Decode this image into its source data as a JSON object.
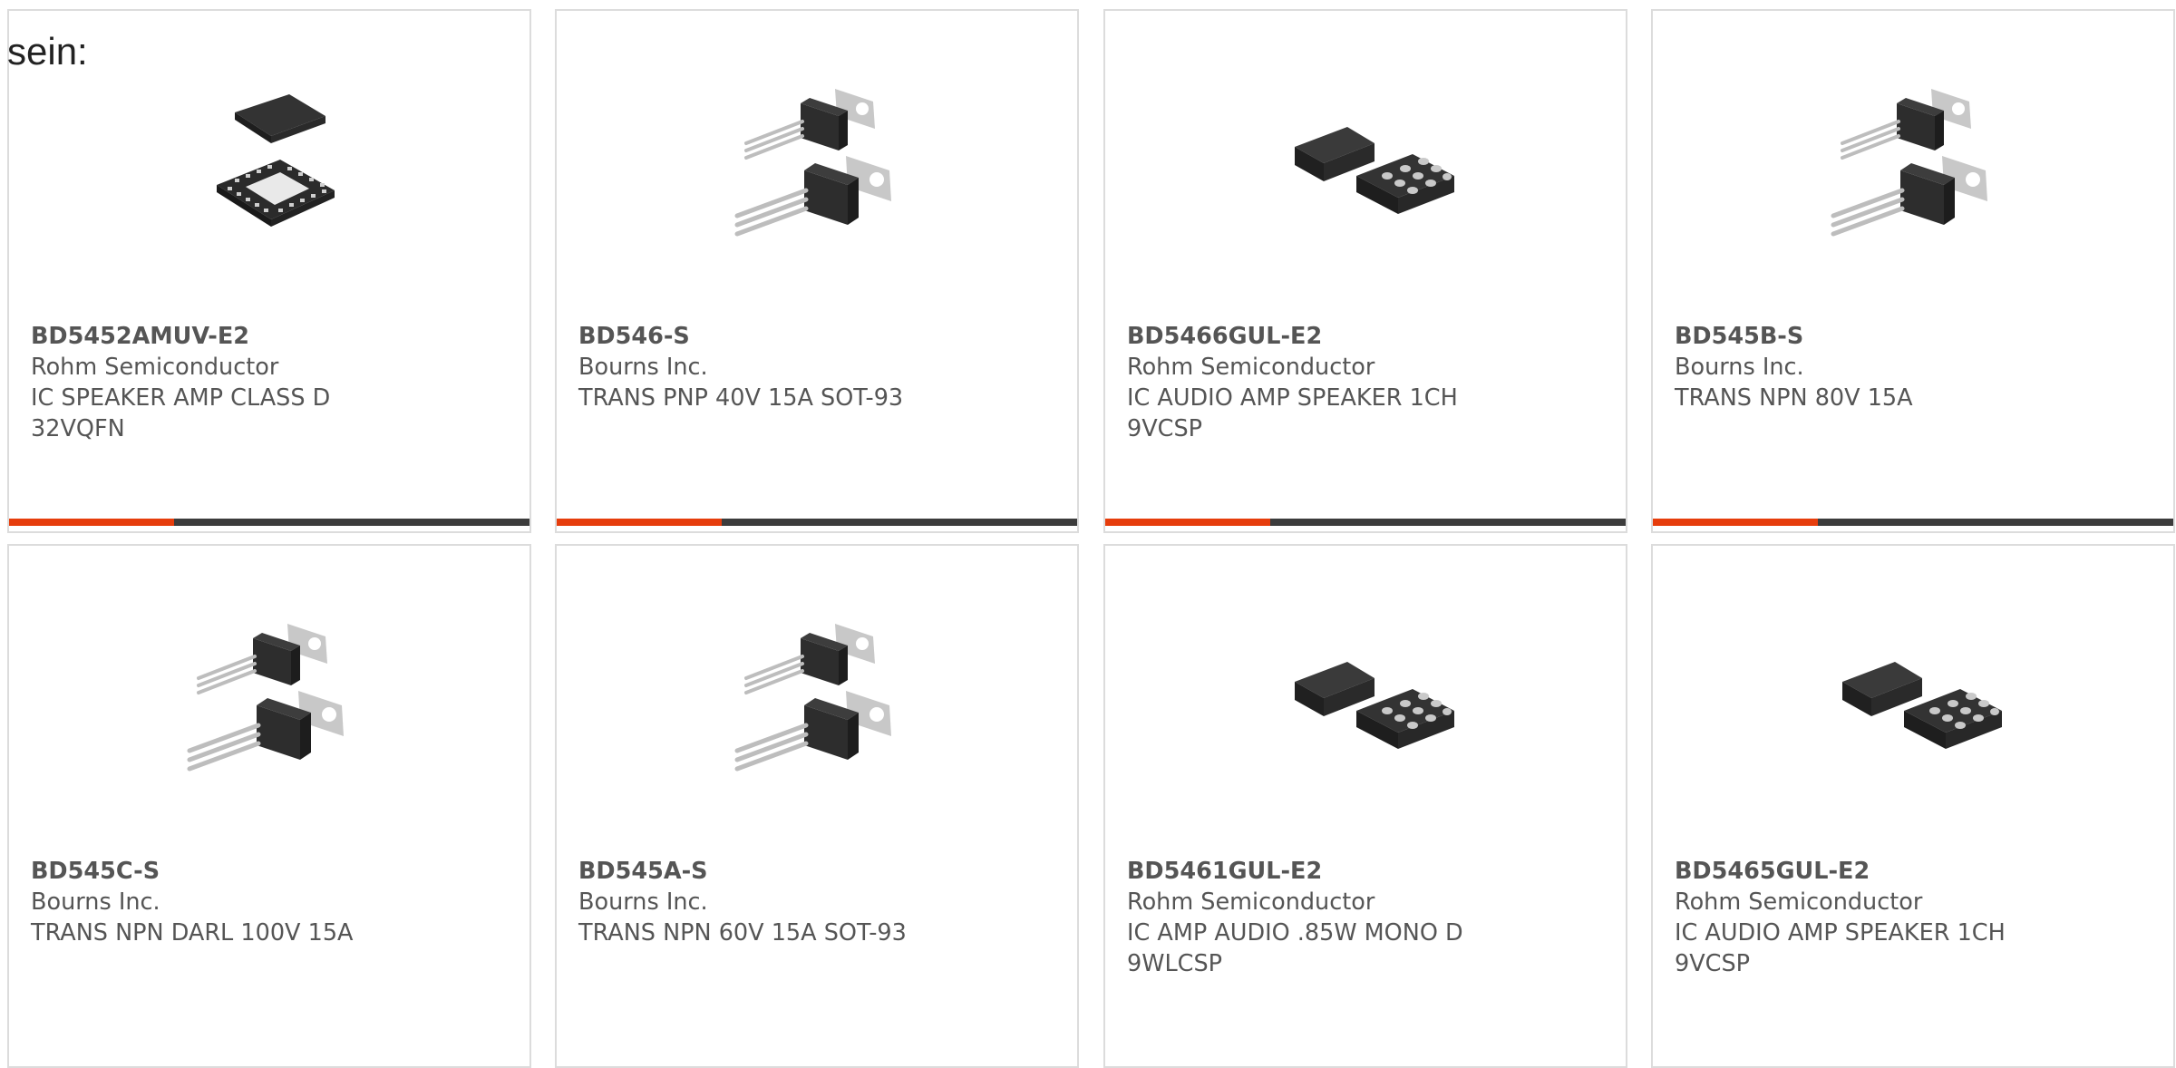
{
  "intro_text": "sein:",
  "products": [
    {
      "part_number": "BD5452AMUV-E2",
      "manufacturer": "Rohm Semiconductor",
      "description": "IC SPEAKER AMP CLASS D 32VQFN",
      "package_icon": "qfn-package-icon"
    },
    {
      "part_number": "BD546-S",
      "manufacturer": "Bourns Inc.",
      "description": "TRANS PNP 40V 15A SOT-93",
      "package_icon": "to-package-icon"
    },
    {
      "part_number": "BD5466GUL-E2",
      "manufacturer": "Rohm Semiconductor",
      "description": "IC AUDIO AMP SPEAKER 1CH 9VCSP",
      "package_icon": "csp-package-icon"
    },
    {
      "part_number": "BD545B-S",
      "manufacturer": "Bourns Inc.",
      "description": "TRANS NPN 80V 15A",
      "package_icon": "to-package-icon"
    },
    {
      "part_number": "BD545C-S",
      "manufacturer": "Bourns Inc.",
      "description": "TRANS NPN DARL 100V 15A",
      "package_icon": "to-package-icon"
    },
    {
      "part_number": "BD545A-S",
      "manufacturer": "Bourns Inc.",
      "description": "TRANS NPN 60V 15A SOT-93",
      "package_icon": "to-package-icon"
    },
    {
      "part_number": "BD5461GUL-E2",
      "manufacturer": "Rohm Semiconductor",
      "description": "IC AMP AUDIO .85W MONO D 9WLCSP",
      "package_icon": "csp-package-icon"
    },
    {
      "part_number": "BD5465GUL-E2",
      "manufacturer": "Rohm Semiconductor",
      "description": "IC AUDIO AMP SPEAKER 1CH 9VCSP",
      "package_icon": "csp-package-icon"
    }
  ],
  "colors": {
    "accent": "#e63d0c",
    "bar": "#3c3c3c",
    "border": "#dcdcdc",
    "text": "#555555"
  }
}
